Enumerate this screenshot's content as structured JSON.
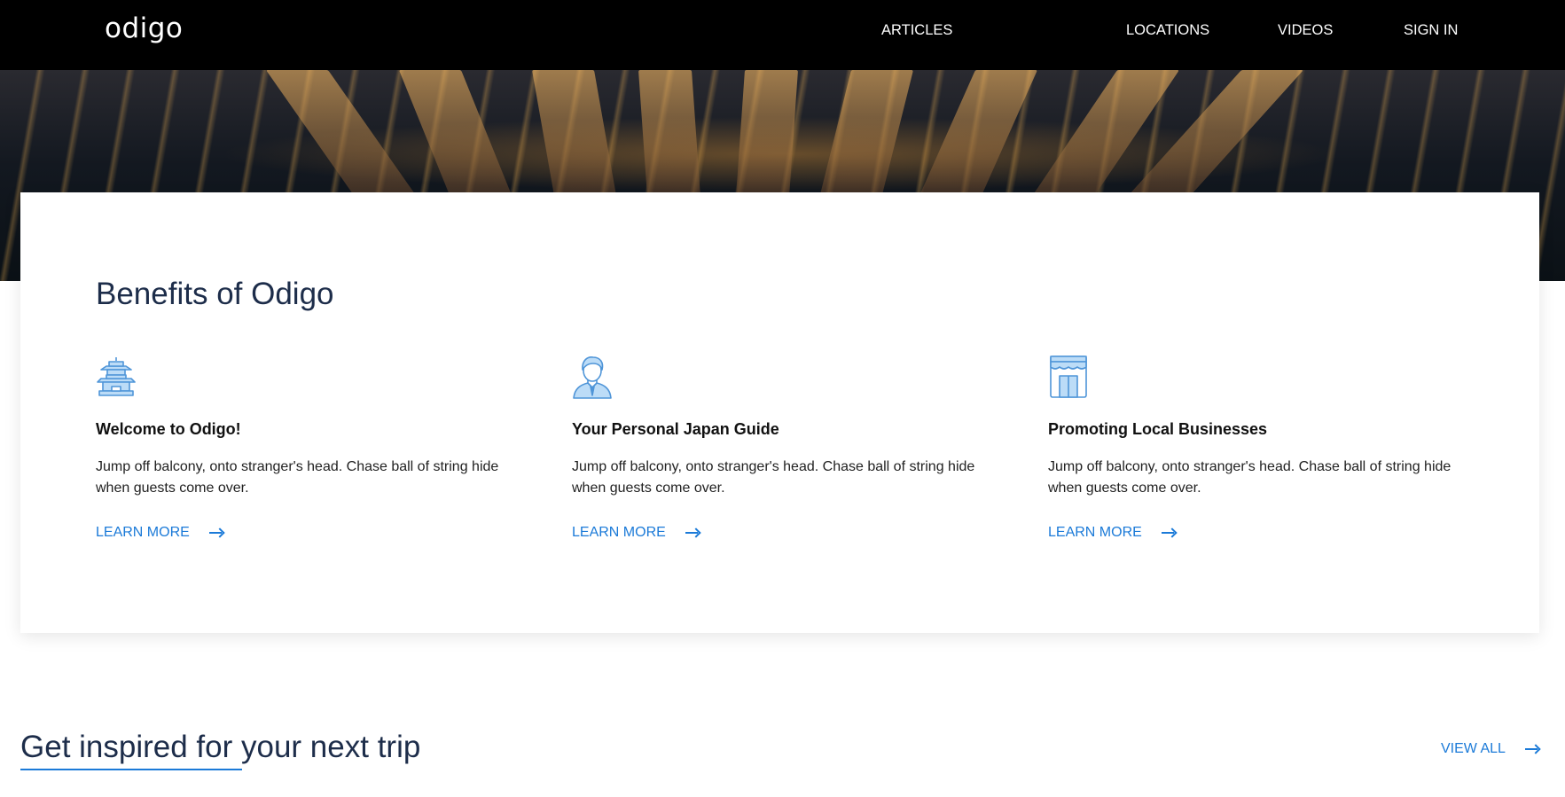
{
  "header": {
    "logo": "odigo",
    "nav": [
      {
        "label": "ARTICLES"
      },
      {
        "label": "LOCATIONS"
      },
      {
        "label": "VIDEOS"
      },
      {
        "label": "SIGN IN"
      }
    ]
  },
  "hero": {
    "image": "night-harbor-piers-image"
  },
  "benefits": {
    "title": "Benefits of Odigo",
    "items": [
      {
        "icon": "pagoda-icon",
        "title": "Welcome to Odigo!",
        "text": "Jump off balcony, onto stranger's head. Chase ball of string hide when guests come over.",
        "link": "LEARN MORE"
      },
      {
        "icon": "guide-person-icon",
        "title": "Your Personal Japan Guide",
        "text": "Jump off balcony, onto stranger's head. Chase ball of string hide when guests come over.",
        "link": "LEARN MORE"
      },
      {
        "icon": "storefront-icon",
        "title": "Promoting Local Businesses",
        "text": "Jump off balcony, onto stranger's head. Chase ball of string hide when guests come over.",
        "link": "LEARN MORE"
      }
    ]
  },
  "inspired": {
    "title": "Get inspired for your next trip",
    "view_all": "VIEW ALL"
  },
  "colors": {
    "accent": "#1b7ad8",
    "heading": "#1d2d4a",
    "header_bg": "#000000"
  }
}
